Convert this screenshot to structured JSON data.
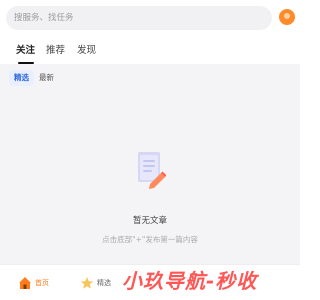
{
  "search": {
    "placeholder": "搜服务、找任务"
  },
  "tabs": [
    {
      "label": "关注",
      "active": true
    },
    {
      "label": "推荐",
      "active": false
    },
    {
      "label": "发现",
      "active": false
    }
  ],
  "sub_tabs": [
    {
      "label": "精选",
      "active": true
    },
    {
      "label": "最新",
      "active": false
    }
  ],
  "empty_state": {
    "title": "暂无文章",
    "subtitle": "点击底部\"+\"发布第一篇内容",
    "icon": "document-edit-icon"
  },
  "bottom_nav": {
    "items": [
      {
        "label": "首页",
        "icon": "home-icon",
        "active": true
      },
      {
        "label": "精选",
        "icon": "star-icon",
        "active": false
      }
    ]
  },
  "watermark": {
    "text": "小玖导航-秒收"
  },
  "colors": {
    "accent": "#ff7a1a",
    "active_chip": "#2b66d9",
    "content_bg": "#f4f4f6"
  }
}
